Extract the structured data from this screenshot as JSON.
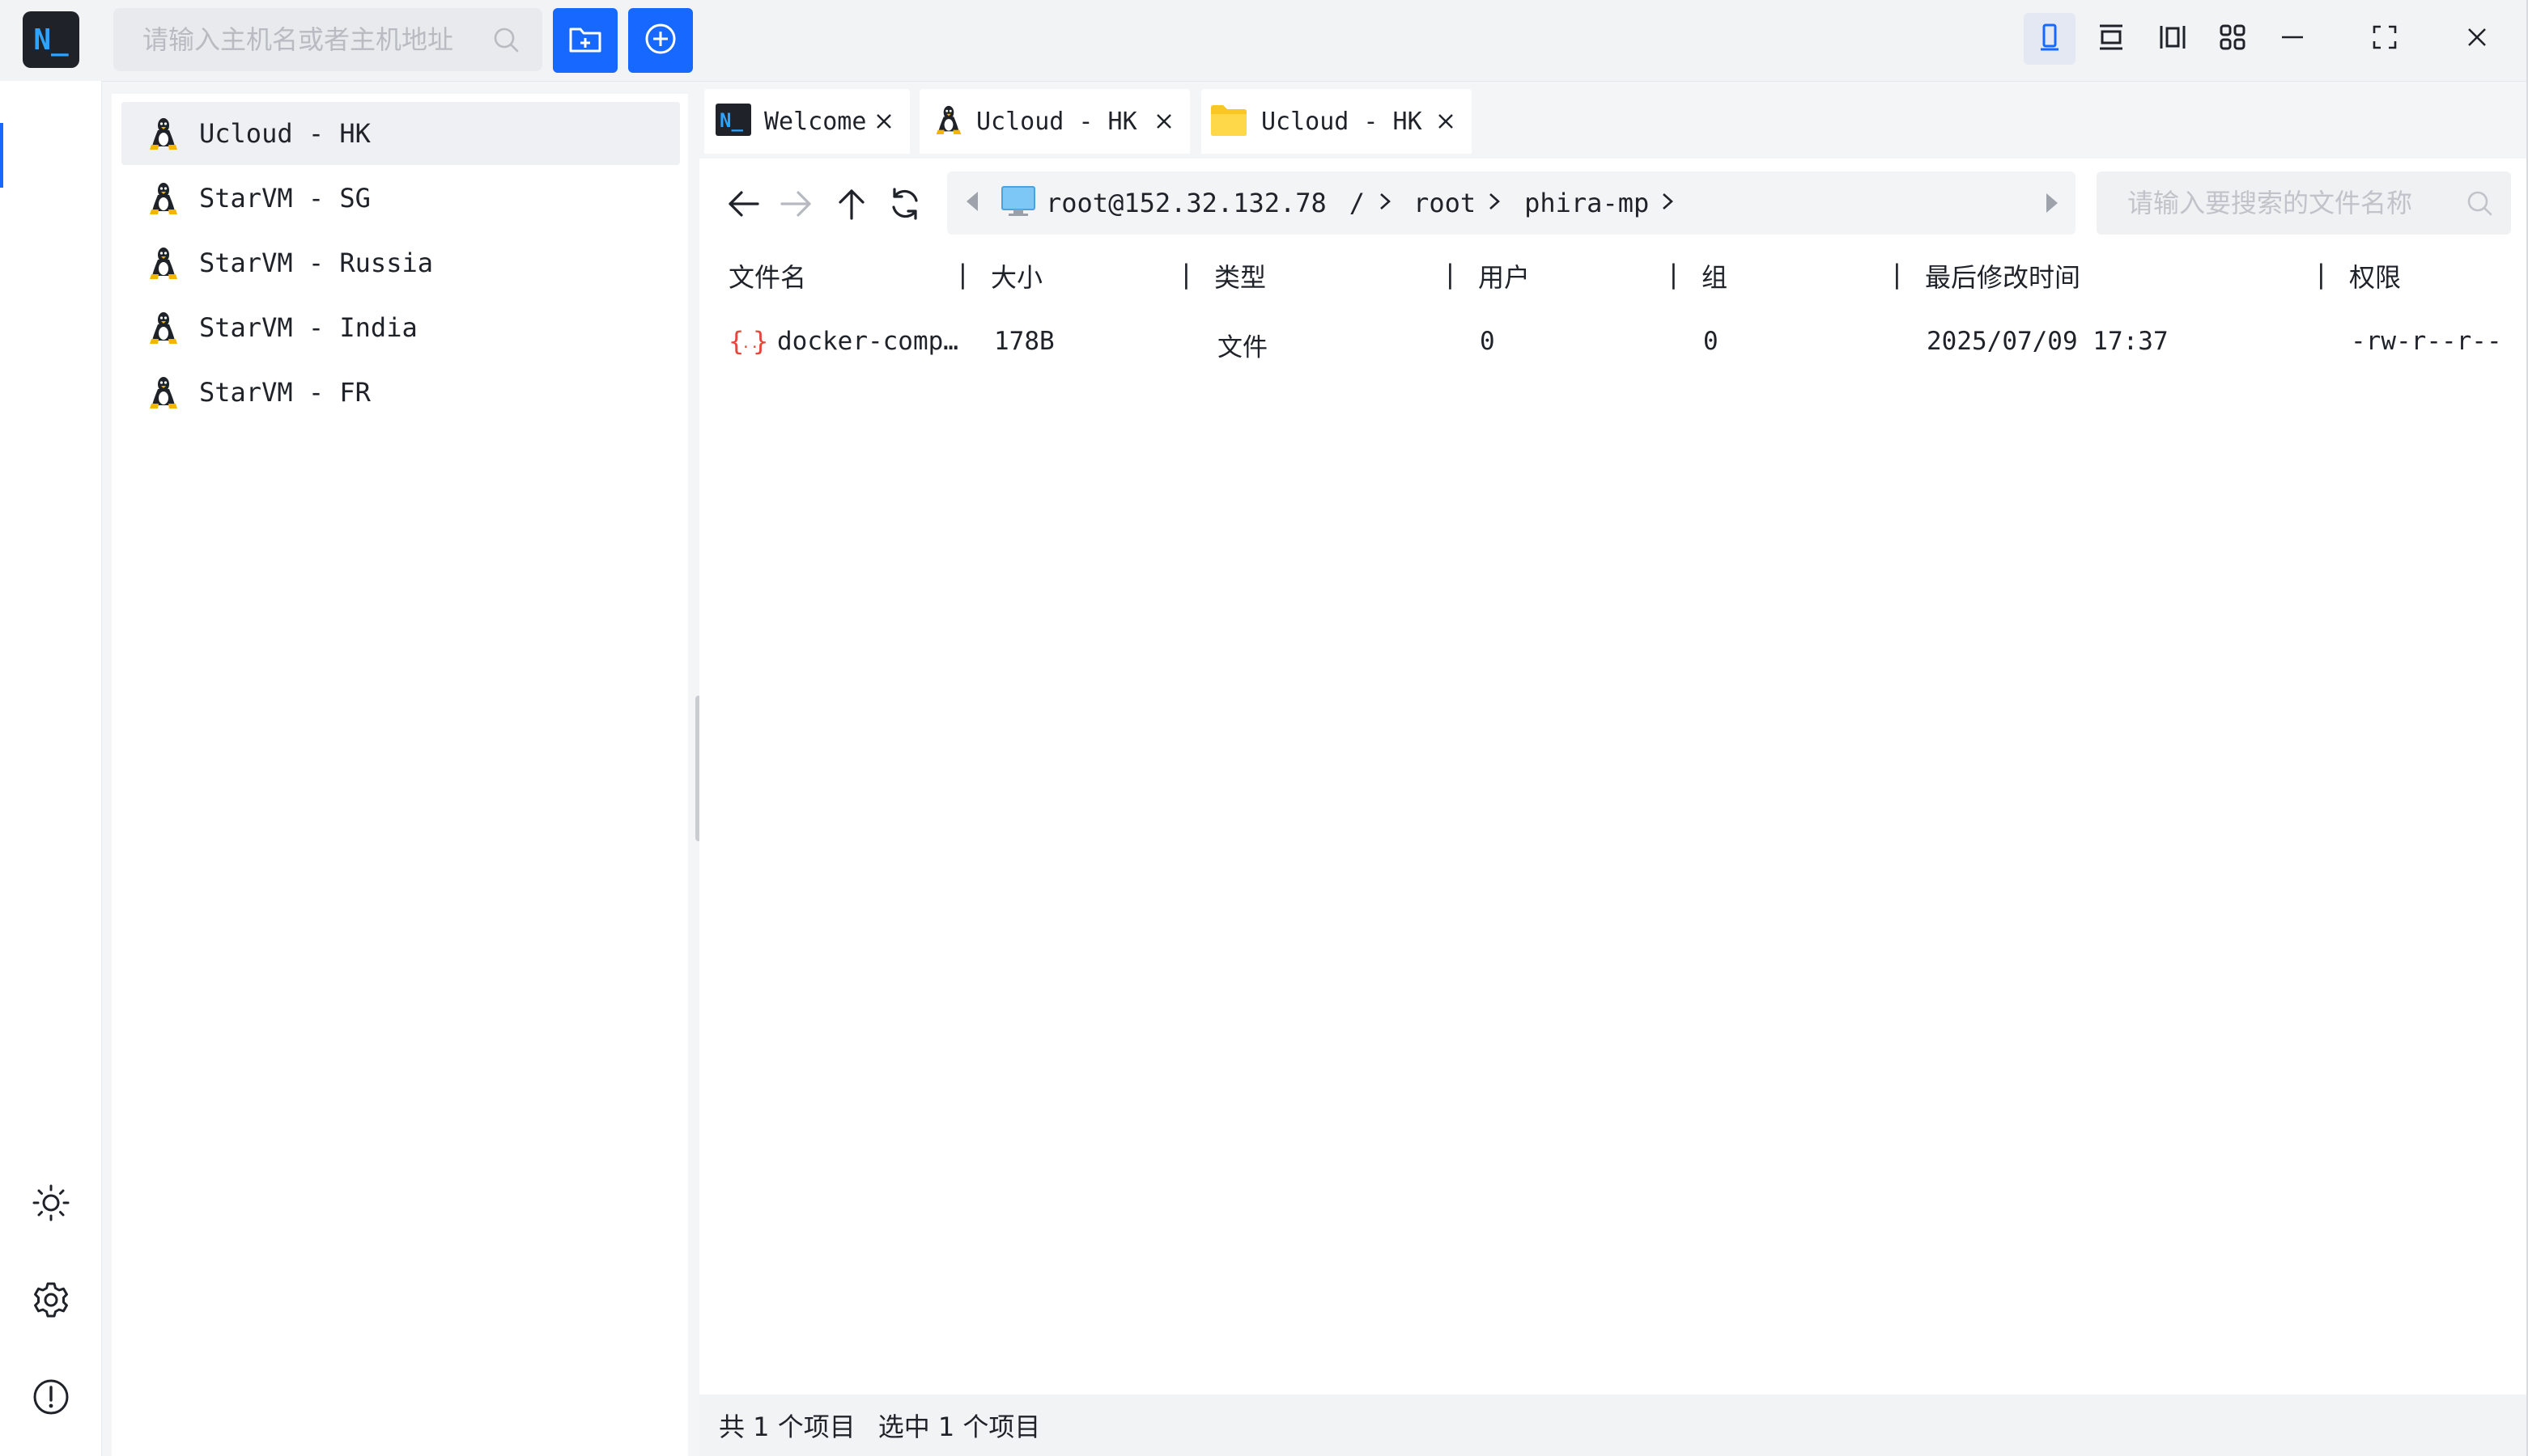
{
  "topbar": {
    "logo_text": "N_",
    "host_search_placeholder": "请输入主机名或者主机地址",
    "icons": [
      "search-icon",
      "folder-plus-icon",
      "plus-circle-icon",
      "layout-single-icon",
      "layout-rows-icon",
      "layout-columns-icon",
      "layout-grid-icon",
      "minimize-icon",
      "maximize-icon",
      "close-icon"
    ],
    "accent_color": "#1668ff"
  },
  "rail": {
    "icons": [
      "sun-icon",
      "gear-icon",
      "info-icon"
    ]
  },
  "hosts": [
    {
      "label": "Ucloud - HK",
      "active": true
    },
    {
      "label": "StarVM - SG",
      "active": false
    },
    {
      "label": "StarVM - Russia",
      "active": false
    },
    {
      "label": "StarVM - India",
      "active": false
    },
    {
      "label": "StarVM - FR",
      "active": false
    }
  ],
  "tabs": [
    {
      "label": "Welcome",
      "icon": "terminal-logo-icon"
    },
    {
      "label": "Ucloud - HK",
      "icon": "linux-icon"
    },
    {
      "label": "Ucloud - HK",
      "icon": "folder-icon"
    }
  ],
  "path": {
    "host": "root@152.32.132.78",
    "segments": [
      "/",
      "root",
      "phira-mp"
    ]
  },
  "file_search_placeholder": "请输入要搜索的文件名称",
  "columns": [
    "文件名",
    "大小",
    "类型",
    "用户",
    "组",
    "最后修改时间",
    "权限"
  ],
  "files": [
    {
      "icon": "json-file-icon",
      "name": "docker-comp…",
      "size": "178B",
      "type": "文件",
      "user": "0",
      "group": "0",
      "modified": "2025/07/09 17:37",
      "perms": "-rw-r--r--"
    }
  ],
  "status": {
    "total": "共 1 个项目",
    "selected": "选中 1 个项目"
  }
}
